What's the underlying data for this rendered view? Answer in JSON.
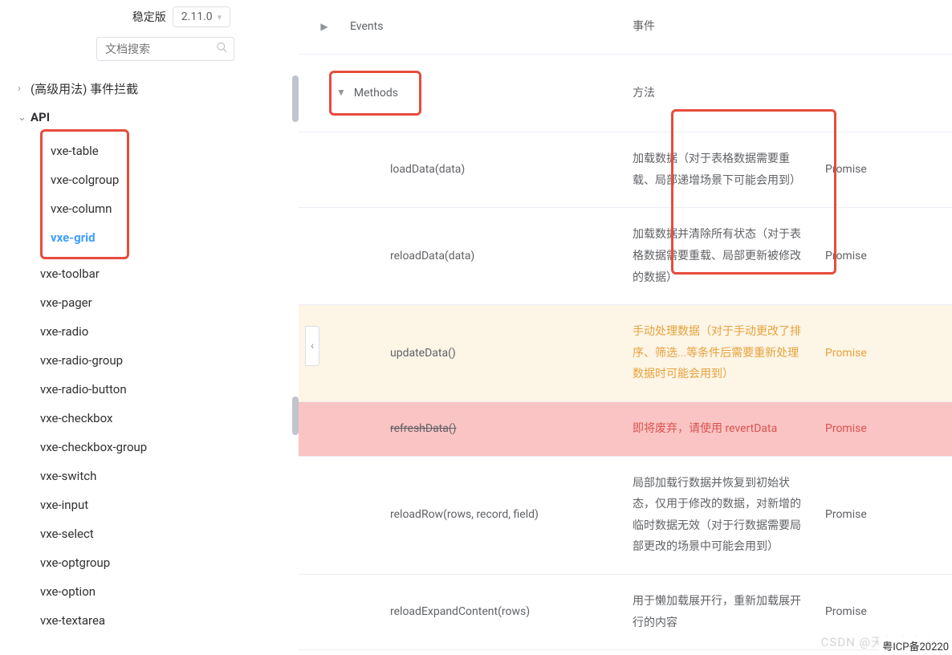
{
  "sidebar": {
    "version_label": "稳定版",
    "version": "2.11.0",
    "search_placeholder": "文档搜索",
    "sections": {
      "advanced": {
        "label": "(高级用法) 事件拦截",
        "expanded": false
      },
      "api": {
        "label": "API",
        "expanded": true
      }
    },
    "api_items": [
      "vxe-table",
      "vxe-colgroup",
      "vxe-column",
      "vxe-grid",
      "vxe-toolbar",
      "vxe-pager",
      "vxe-radio",
      "vxe-radio-group",
      "vxe-radio-button",
      "vxe-checkbox",
      "vxe-checkbox-group",
      "vxe-switch",
      "vxe-input",
      "vxe-select",
      "vxe-optgroup",
      "vxe-option",
      "vxe-textarea"
    ],
    "active_index": 3
  },
  "table": {
    "events": {
      "name": "Events",
      "desc": "事件"
    },
    "methods": {
      "name": "Methods",
      "desc": "方法"
    },
    "rows": [
      {
        "name": "loadData(data)",
        "desc": "加载数据（对于表格数据需要重载、局部递增场景下可能会用到）",
        "ret": "Promise",
        "style": "normal"
      },
      {
        "name": "reloadData(data)",
        "desc": "加载数据并清除所有状态（对于表格数据需要重载、局部更新被修改的数据）",
        "ret": "Promise",
        "style": "normal"
      },
      {
        "name": "updateData()",
        "desc": "手动处理数据（对于手动更改了排序、筛选...等条件后需要重新处理数据时可能会用到）",
        "ret": "Promise",
        "style": "warn"
      },
      {
        "name": "refreshData()",
        "desc": "即将废弃，请使用 revertData",
        "ret": "Promise",
        "style": "danger",
        "strike": true
      },
      {
        "name": "reloadRow(rows, record, field)",
        "desc": "局部加载行数据并恢复到初始状态，仅用于修改的数据，对新增的临时数据无效（对于行数据需要局部更改的场景中可能会用到）",
        "ret": "Promise",
        "style": "normal"
      },
      {
        "name": "reloadExpandContent(rows)",
        "desc": "用于懒加载展开行，重新加载展开行的内容",
        "ret": "Promise",
        "style": "normal"
      }
    ]
  },
  "watermark": "CSDN @天气晚来秋.",
  "icp": "粤ICP备20220"
}
